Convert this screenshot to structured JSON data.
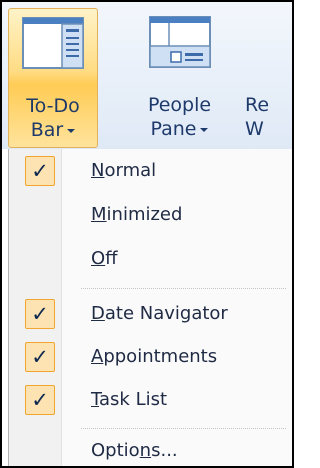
{
  "ribbon": {
    "buttons": [
      {
        "label_line1": "To-Do",
        "label_line2": "Bar",
        "icon": "todo-bar-layout-icon",
        "active": true
      },
      {
        "label_line1": "People",
        "label_line2": "Pane",
        "icon": "people-pane-layout-icon",
        "active": false
      },
      {
        "label_line1": "Re",
        "label_line2": "W",
        "icon": "reading-pane-icon",
        "active": false
      }
    ]
  },
  "menu": {
    "items": [
      {
        "label": "Normal",
        "accel": "N",
        "checked": true
      },
      {
        "label": "Minimized",
        "accel": "M",
        "checked": false
      },
      {
        "label": "Off",
        "accel": "O",
        "checked": false
      },
      {
        "label": "Date Navigator",
        "accel": "D",
        "checked": true
      },
      {
        "label": "Appointments",
        "accel": "A",
        "checked": true
      },
      {
        "label": "Task List",
        "accel": "T",
        "checked": true
      },
      {
        "label": "Options...",
        "accel": "n",
        "checked": false
      }
    ],
    "check_glyph": "✓"
  },
  "colors": {
    "active_fill": "#ffd877",
    "active_border": "#e1b25a",
    "check_fill": "#fde3b2",
    "check_border": "#f0a630",
    "label_text": "#1e3a6a"
  }
}
